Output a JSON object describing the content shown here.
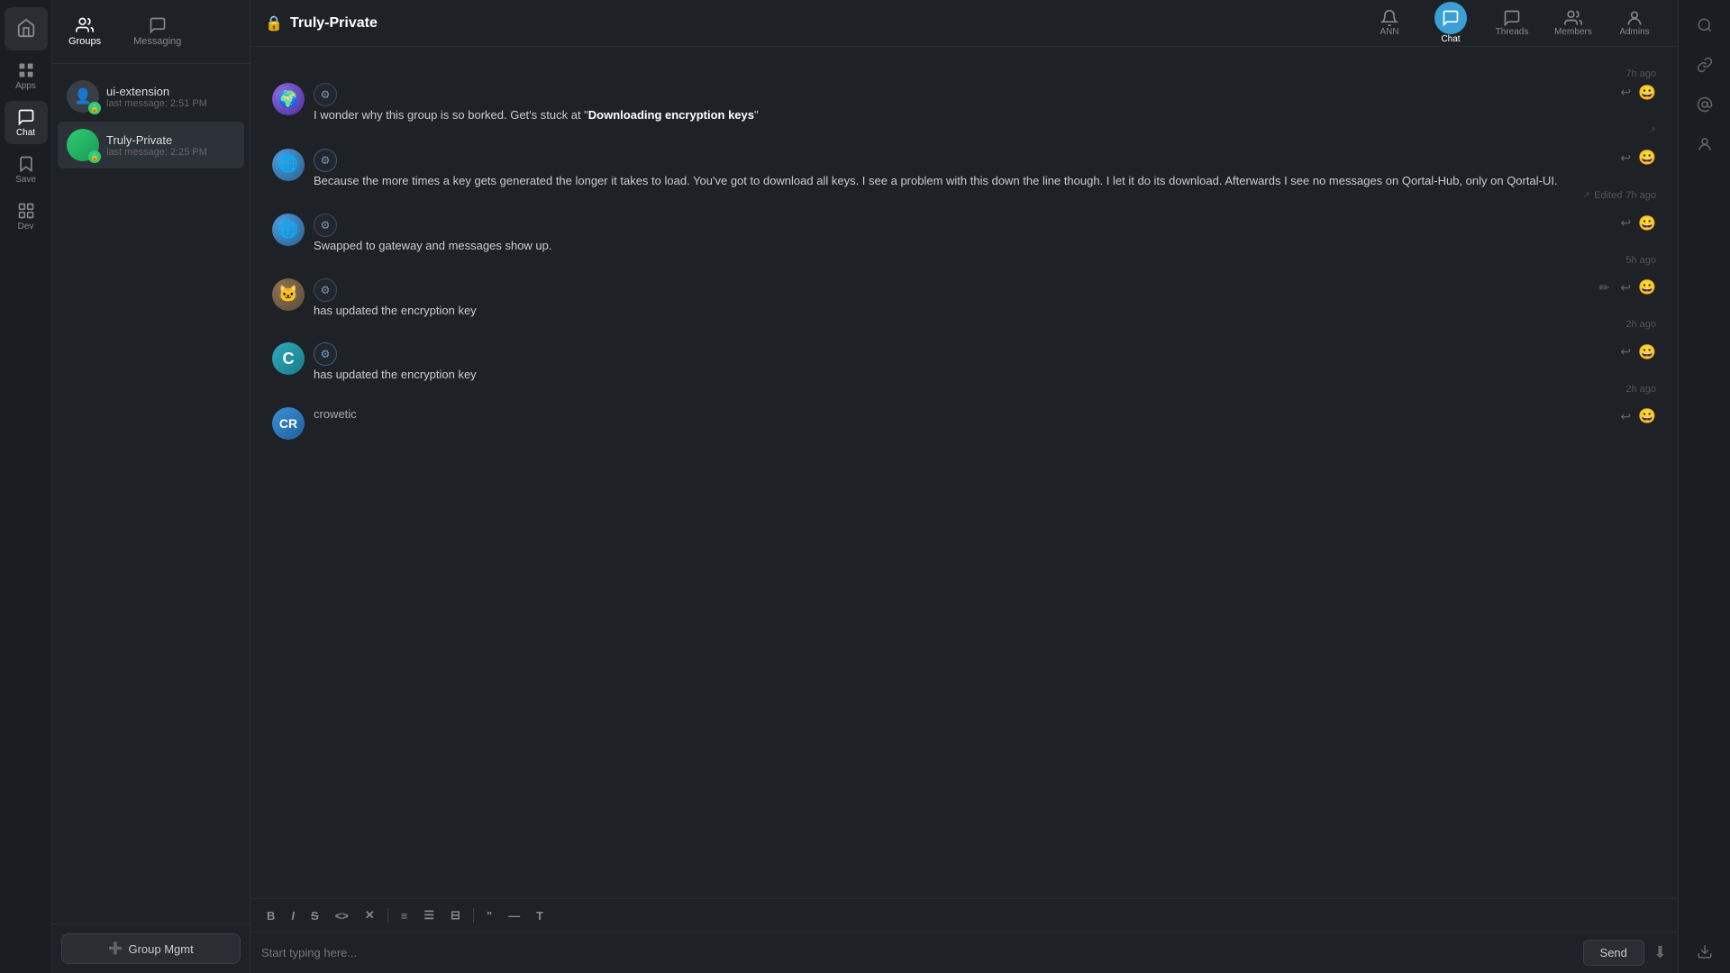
{
  "app": {
    "title": "Truly-Private"
  },
  "left_nav": {
    "items": [
      {
        "id": "home",
        "icon": "🏠",
        "label": ""
      },
      {
        "id": "apps",
        "icon": "⊞",
        "label": "Apps"
      },
      {
        "id": "chat",
        "icon": "💬",
        "label": "Chat"
      },
      {
        "id": "save",
        "icon": "🔖",
        "label": "Save"
      },
      {
        "id": "dev",
        "icon": "⊞",
        "label": "Dev"
      }
    ]
  },
  "channel_list": {
    "tabs": [
      {
        "id": "groups",
        "label": "Groups"
      },
      {
        "id": "messaging",
        "label": "Messaging"
      }
    ],
    "channels": [
      {
        "id": "ui-extension",
        "name": "ui-extension",
        "last_message": "last message: 2:51 PM",
        "has_lock": true,
        "active": false
      },
      {
        "id": "truly-private",
        "name": "Truly-Private",
        "last_message": "last message: 2:25 PM",
        "has_lock": true,
        "active": true
      }
    ],
    "footer": {
      "group_mgmt_label": "Group Mgmt"
    }
  },
  "top_nav": {
    "items": [
      {
        "id": "ann",
        "label": "ANN",
        "icon": "🔔"
      },
      {
        "id": "chat",
        "label": "Chat",
        "icon": "💬",
        "active": true
      },
      {
        "id": "threads",
        "label": "Threads",
        "icon": "🗨"
      },
      {
        "id": "members",
        "label": "Members",
        "icon": "👥"
      },
      {
        "id": "admins",
        "label": "Admins",
        "icon": "🔑"
      }
    ]
  },
  "messages": [
    {
      "id": "msg1",
      "time_divider": "7h ago",
      "avatar_style": "purple",
      "sender_badge": "gear",
      "text": "I wonder why this group is so borked. Get's stuck at \"Downloading encryption keys\"",
      "bold_text": "Downloading encryption keys",
      "show_actions": true,
      "show_edit": false,
      "edited": false,
      "msg_time": ""
    },
    {
      "id": "msg2",
      "time_divider": "",
      "avatar_style": "blue-planet",
      "sender_badge": "gear2",
      "text": "Because the more times a key gets generated the longer it takes to load. You've got to download all keys. I see a problem with this down the line though. I let it do its download. Afterwards I see no messages on Qortal-Hub, only on Qortal-UI.",
      "bold_text": "",
      "show_actions": true,
      "show_edit": false,
      "edited": true,
      "msg_time": "7h ago",
      "edited_label": "Edited"
    },
    {
      "id": "msg3",
      "time_divider": "",
      "avatar_style": "blue-planet",
      "sender_badge": "gear3",
      "text": "Swapped to gateway and messages show up.",
      "bold_text": "",
      "show_actions": true,
      "show_edit": false,
      "edited": false,
      "msg_time": "",
      "time_bottom": "5h ago"
    },
    {
      "id": "msg4",
      "time_divider": "5h ago",
      "avatar_style": "cat",
      "sender_badge": "gear",
      "text": "has updated the encryption key",
      "bold_text": "",
      "show_actions": true,
      "show_edit": true,
      "edited": false,
      "msg_time": "2h ago"
    },
    {
      "id": "msg5",
      "time_divider": "",
      "avatar_style": "teal-c",
      "avatar_text": "C",
      "sender_badge": "gear2",
      "text": "has updated the encryption key",
      "bold_text": "",
      "show_actions": true,
      "show_edit": false,
      "edited": false,
      "msg_time": "2h ago"
    },
    {
      "id": "msg6",
      "time_divider": "",
      "avatar_style": "crowetic",
      "sender_name": "crowetic",
      "sender_badge": "none",
      "text": "",
      "bold_text": "",
      "show_actions": true,
      "show_edit": false,
      "edited": false,
      "msg_time": ""
    }
  ],
  "editor": {
    "toolbar": [
      {
        "id": "bold",
        "label": "B"
      },
      {
        "id": "italic",
        "label": "I"
      },
      {
        "id": "strike",
        "label": "S"
      },
      {
        "id": "code",
        "label": "<>"
      },
      {
        "id": "clear",
        "label": "✕"
      },
      {
        "id": "bullet",
        "label": "≡"
      },
      {
        "id": "ordered",
        "label": "1."
      },
      {
        "id": "indent",
        "label": "⊞"
      },
      {
        "id": "quote",
        "label": "\""
      },
      {
        "id": "hr",
        "label": "—"
      },
      {
        "id": "heading",
        "label": "T"
      }
    ],
    "placeholder": "Start typing here...",
    "send_label": "Send"
  },
  "right_sidebar": {
    "icons": [
      {
        "id": "search",
        "icon": "🔍"
      },
      {
        "id": "link",
        "icon": "🔗"
      },
      {
        "id": "mention",
        "icon": "@"
      },
      {
        "id": "avatar",
        "icon": "👤"
      },
      {
        "id": "download",
        "icon": "⬇"
      }
    ]
  }
}
